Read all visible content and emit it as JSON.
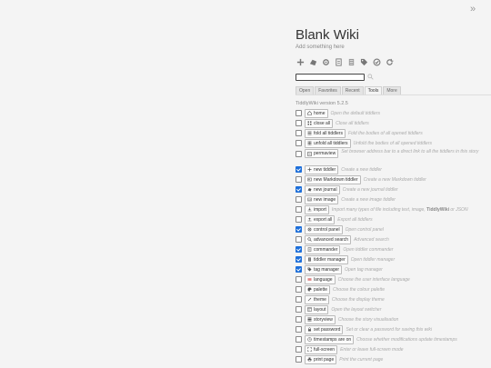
{
  "site": {
    "title": "Blank Wiki",
    "subtitle": "Add something here"
  },
  "page_controls": [
    {
      "icon": "plus-icon"
    },
    {
      "icon": "journal-icon"
    },
    {
      "icon": "gear-icon"
    },
    {
      "icon": "document-icon"
    },
    {
      "icon": "book-icon"
    },
    {
      "icon": "tag-icon"
    },
    {
      "icon": "check-circle-icon"
    },
    {
      "icon": "refresh-icon"
    }
  ],
  "search": {
    "value": "",
    "placeholder": ""
  },
  "tabs": [
    {
      "label": "Open",
      "active": false
    },
    {
      "label": "Favorites",
      "active": false
    },
    {
      "label": "Recent",
      "active": false
    },
    {
      "label": "Tools",
      "active": true
    },
    {
      "label": "More",
      "active": false
    }
  ],
  "version": "TiddlyWiki version 5.2.5",
  "tools": [
    {
      "label": "home",
      "desc": "Open the default tiddlers",
      "checked": false,
      "icon": "home-icon"
    },
    {
      "label": "close all",
      "desc": "Close all tiddlers",
      "checked": false,
      "icon": "grid-icon"
    },
    {
      "label": "fold all tiddlers",
      "desc": "Fold the bodies of all opened tiddlers",
      "checked": false,
      "icon": "fold-icon"
    },
    {
      "label": "unfold all tiddlers",
      "desc": "Unfold the bodies of all opened tiddlers",
      "checked": false,
      "icon": "unfold-icon"
    },
    {
      "label": "permaview",
      "desc": "Set browser address bar to a direct link to all the tiddlers in this story",
      "checked": false,
      "icon": "permaview-icon",
      "tall": true
    },
    {
      "label": "new tiddler",
      "desc": "Create a new tiddler",
      "checked": true,
      "icon": "plus-icon"
    },
    {
      "label": "new Markdown tiddler",
      "desc": "Create a new Markdown tiddler",
      "checked": false,
      "icon": "markdown-icon"
    },
    {
      "label": "new journal",
      "desc": "Create a new journal tiddler",
      "checked": true,
      "icon": "journal-icon"
    },
    {
      "label": "new image",
      "desc": "Create a new image tiddler",
      "checked": false,
      "icon": "image-icon"
    },
    {
      "label": "import",
      "desc": "Import many types of file including text, image,",
      "desc_bold": "TiddlyWiki",
      "desc_tail": "or JSON",
      "checked": false,
      "icon": "import-icon"
    },
    {
      "label": "export all",
      "desc": "Export all tiddlers",
      "checked": false,
      "icon": "export-icon"
    },
    {
      "label": "control panel",
      "desc": "Open control panel",
      "checked": true,
      "icon": "gear-icon"
    },
    {
      "label": "advanced search",
      "desc": "Advanced search",
      "checked": false,
      "icon": "search-icon"
    },
    {
      "label": "commander",
      "desc": "Open tiddler commander",
      "checked": true,
      "icon": "document-icon"
    },
    {
      "label": "tiddler manager",
      "desc": "Open tiddler manager",
      "checked": true,
      "icon": "book-icon"
    },
    {
      "label": "tag manager",
      "desc": "Open tag manager",
      "checked": true,
      "icon": "tag-icon"
    },
    {
      "label": "language",
      "desc": "Choose the user interface language",
      "checked": false,
      "icon": "flag-icon"
    },
    {
      "label": "palette",
      "desc": "Choose the colour palette",
      "checked": false,
      "icon": "palette-icon"
    },
    {
      "label": "theme",
      "desc": "Choose the display theme",
      "checked": false,
      "icon": "theme-icon"
    },
    {
      "label": "layout",
      "desc": "Open the layout switcher",
      "checked": false,
      "icon": "layout-icon"
    },
    {
      "label": "storyview",
      "desc": "Choose the story visualisation",
      "checked": false,
      "icon": "storyview-icon"
    },
    {
      "label": "set password",
      "desc": "Set or clear a password for saving this wiki",
      "checked": false,
      "icon": "lock-icon"
    },
    {
      "label": "timestamps are on",
      "desc": "Choose whether modifications update timestamps",
      "checked": false,
      "icon": "clock-icon"
    },
    {
      "label": "full-screen",
      "desc": "Enter or leave full-screen mode",
      "checked": false,
      "icon": "fullscreen-icon"
    },
    {
      "label": "print page",
      "desc": "Print the current page",
      "checked": false,
      "icon": "print-icon"
    }
  ],
  "colors": {
    "accent": "#1e6fd9",
    "background": "#f4f4f4"
  }
}
